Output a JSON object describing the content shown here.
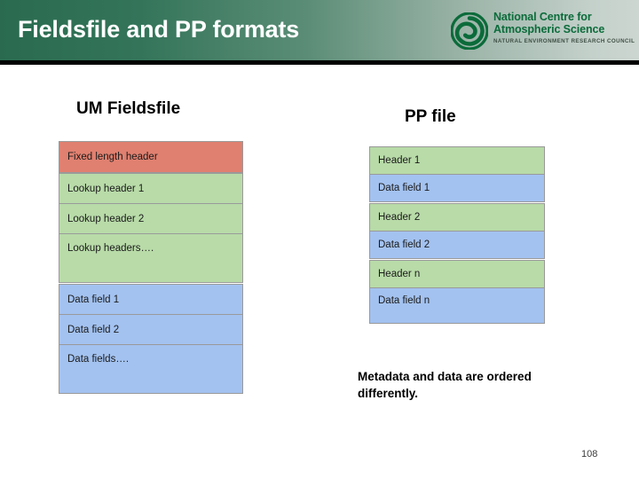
{
  "header": {
    "title": "Fieldsfile and PP formats",
    "logo": {
      "icon": "ncas-spiral-logo",
      "line1": "National Centre for",
      "line2": "Atmospheric Science",
      "subtitle": "NATURAL ENVIRONMENT RESEARCH COUNCIL"
    }
  },
  "colors": {
    "banner_start": "#2a6b4f",
    "banner_end": "#c3d0ca",
    "header_red": "#e08070",
    "metadata_green": "#b8dba8",
    "data_blue": "#a3c2f0",
    "border_gray": "#9a9a9a",
    "logo_green": "#0b6b3a"
  },
  "left_column": {
    "heading": "UM Fieldsfile",
    "fixed_header": "Fixed length header",
    "lookup_rows": [
      "Lookup header 1",
      "Lookup header 2",
      "Lookup headers…."
    ],
    "data_rows": [
      "Data field 1",
      "Data field 2",
      "Data fields…."
    ]
  },
  "right_column": {
    "heading": "PP file",
    "groups": [
      {
        "header": "Header 1",
        "data": "Data field 1"
      },
      {
        "header": "Header 2",
        "data": "Data field 2"
      },
      {
        "header": "Header n",
        "data": "Data field n"
      }
    ]
  },
  "caption": "Metadata and data are ordered differently.",
  "page_number": "108"
}
